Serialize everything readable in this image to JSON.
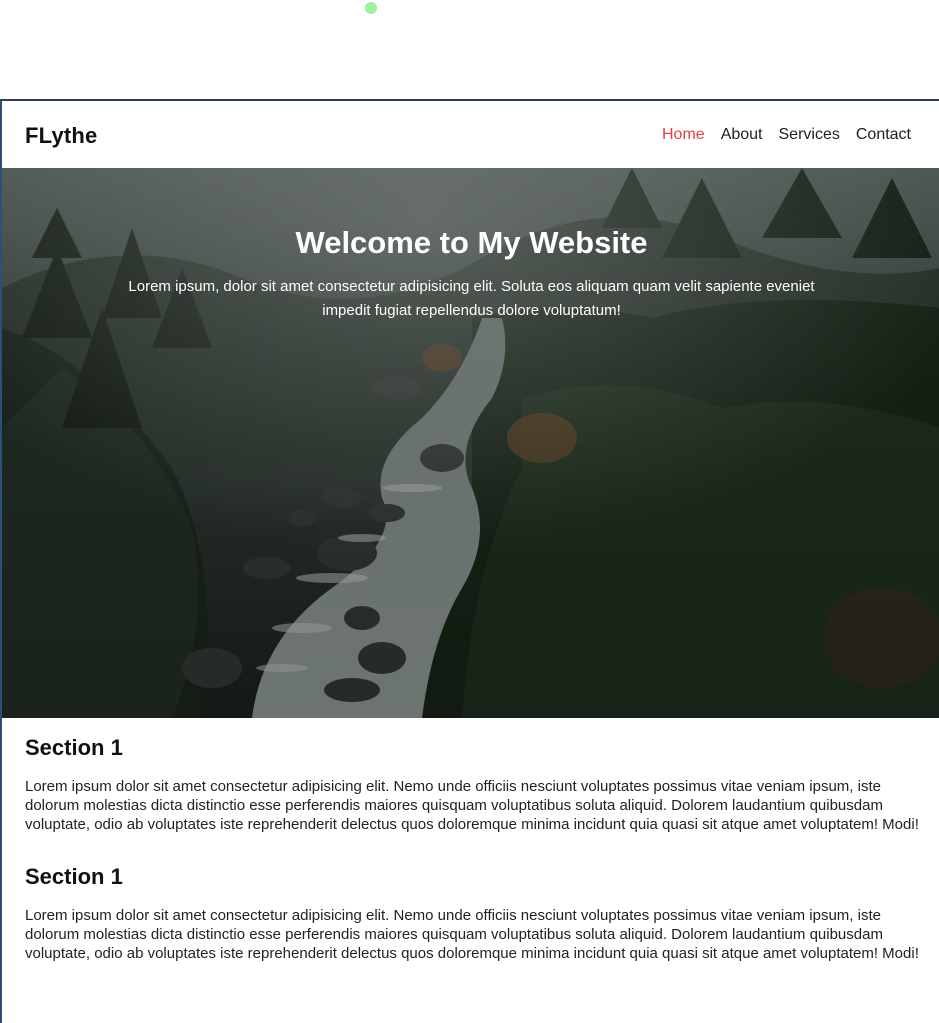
{
  "brand": "FLythe",
  "nav": {
    "items": [
      {
        "label": "Home",
        "active": true
      },
      {
        "label": "About",
        "active": false
      },
      {
        "label": "Services",
        "active": false
      },
      {
        "label": "Contact",
        "active": false
      }
    ]
  },
  "hero": {
    "title": "Welcome to My Website",
    "text": "Lorem ipsum, dolor sit amet consectetur adipisicing elit. Soluta eos aliquam quam velit sapiente eveniet impedit fugiat repellendus dolore voluptatum!"
  },
  "sections": [
    {
      "title": "Section 1",
      "text": "Lorem ipsum dolor sit amet consectetur adipisicing elit. Nemo unde officiis nesciunt voluptates possimus vitae veniam ipsum, iste dolorum molestias dicta distinctio esse perferendis maiores quisquam voluptatibus soluta aliquid. Dolorem laudantium quibusdam voluptate, odio ab voluptates iste reprehenderit delectus quos doloremque minima incidunt quia quasi sit atque amet voluptatem! Modi!"
    },
    {
      "title": "Section 1",
      "text": "Lorem ipsum dolor sit amet consectetur adipisicing elit. Nemo unde officiis nesciunt voluptates possimus vitae veniam ipsum, iste dolorum molestias dicta distinctio esse perferendis maiores quisquam voluptatibus soluta aliquid. Dolorem laudantium quibusdam voluptate, odio ab voluptates iste reprehenderit delectus quos doloremque minima incidunt quia quasi sit atque amet voluptatem! Modi!"
    }
  ],
  "colors": {
    "accent": "#e0414b",
    "status_dot": "#9af29a",
    "frame_border": "#2d3e55"
  }
}
